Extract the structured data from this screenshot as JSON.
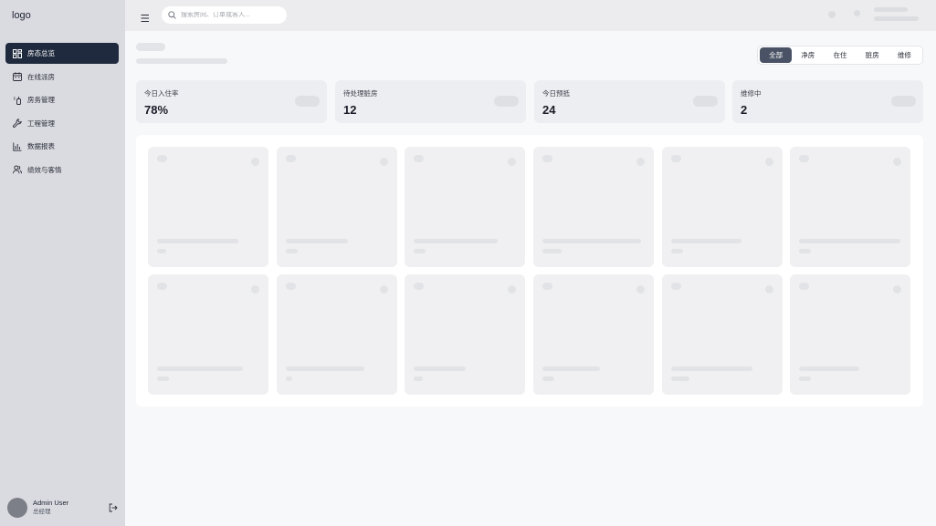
{
  "sidebar": {
    "logo": "logo",
    "items": [
      {
        "label": "房态总览",
        "icon": "grid-icon",
        "active": true
      },
      {
        "label": "在线派房",
        "icon": "calendar-icon",
        "active": false
      },
      {
        "label": "房务管理",
        "icon": "cleaning-icon",
        "active": false
      },
      {
        "label": "工程管理",
        "icon": "wrench-icon",
        "active": false
      },
      {
        "label": "数据报表",
        "icon": "bar-chart-icon",
        "active": false
      },
      {
        "label": "绩效与客情",
        "icon": "users-icon",
        "active": false
      }
    ],
    "user": {
      "name": "Admin User",
      "role": "总经理"
    }
  },
  "topbar": {
    "search_placeholder": "搜索房间、订单或客人..."
  },
  "filters": {
    "tabs": [
      "全部",
      "净房",
      "在住",
      "脏房",
      "维修"
    ],
    "active": "全部"
  },
  "stats": [
    {
      "label": "今日入住率",
      "value": "78%"
    },
    {
      "label": "待处理脏房",
      "value": "12"
    },
    {
      "label": "今日预抵",
      "value": "24"
    },
    {
      "label": "维修中",
      "value": "2"
    }
  ],
  "colors": {
    "sidebar_bg": "#d9dbe0",
    "active_nav": "#1f2a3e",
    "active_filter": "#4a5365",
    "page_bg": "#f7f8fa"
  }
}
